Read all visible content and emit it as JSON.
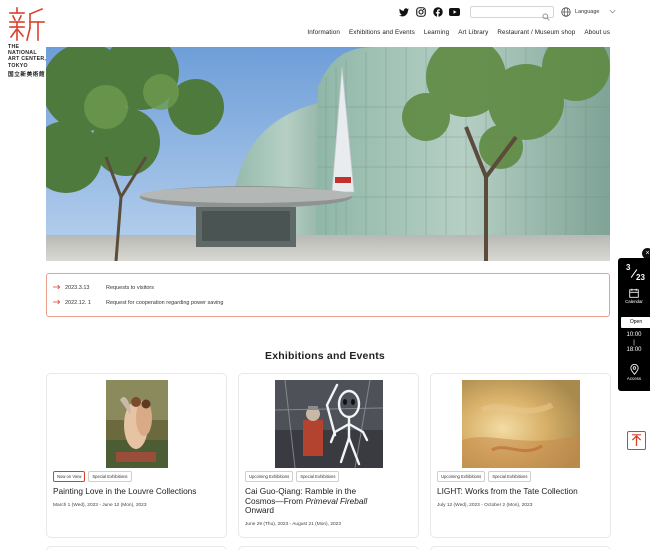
{
  "logo": {
    "lines": [
      "THE",
      "NATIONAL",
      "ART CENTER,",
      "TOKYO"
    ],
    "jp": "国立新美術館"
  },
  "utility": {
    "social_icons": [
      "twitter-icon",
      "instagram-icon",
      "facebook-icon",
      "youtube-icon"
    ],
    "search_placeholder": "",
    "language_label": "Language"
  },
  "nav": {
    "items": [
      "Information",
      "Exhibitions and Events",
      "Learning",
      "Art Library",
      "Restaurant / Museum shop",
      "About us"
    ]
  },
  "notices": [
    {
      "date": "2023.3.13",
      "text": "Requests to visitors"
    },
    {
      "date": "2022.12. 1",
      "text": "Request for cooperation regarding power saving"
    }
  ],
  "sidebar": {
    "month": "3",
    "day": "23",
    "calendar_label": "Calendar",
    "status": "Open",
    "open_time": "10:00",
    "close_time": "18:00",
    "access_label": "Access"
  },
  "section_title": "Exhibitions and Events",
  "cards": [
    {
      "tags": [
        "Now on View",
        "Special Exhibitions"
      ],
      "title": "Painting Love in the Louvre Collections",
      "dates": "March 1 (Wed), 2023 - June 12 (Mon), 2023"
    },
    {
      "tags": [
        "Upcoming Exhibitions",
        "Special Exhibitions"
      ],
      "title_line1": "Cai Guo-Qiang: Ramble in the",
      "title_line2_prefix": "Cosmos—From ",
      "title_line2_italic": "Primeval Fireball",
      "title_line3": "Onward",
      "dates": "June 29 (Thu), 2023 - August 21 (Mon), 2023"
    },
    {
      "tags": [
        "Upcoming Exhibitions",
        "Special Exhibitions"
      ],
      "title": "LIGHT: Works from the Tate Collection",
      "dates": "July 12 (Wed), 2023 - October 2 (Mon), 2023"
    }
  ],
  "colors": {
    "accent_red": "#d9402b",
    "notice_border": "#e9a08e",
    "sidebar_bg": "#000000"
  }
}
